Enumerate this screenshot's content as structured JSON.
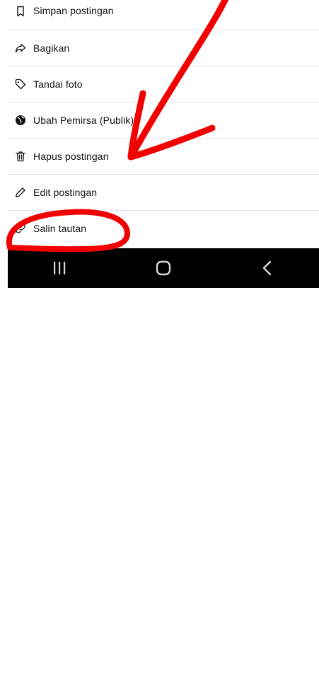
{
  "menu": {
    "items": [
      {
        "label": "Simpan postingan",
        "icon": "bookmark-icon"
      },
      {
        "label": "Bagikan",
        "icon": "share-icon"
      },
      {
        "label": "Tandai foto",
        "icon": "tag-icon"
      },
      {
        "label": "Ubah Pemirsa (Publik)",
        "icon": "globe-icon"
      },
      {
        "label": "Hapus postingan",
        "icon": "trash-icon"
      },
      {
        "label": "Edit postingan",
        "icon": "pencil-icon"
      },
      {
        "label": "Salin tautan",
        "icon": "link-icon"
      }
    ]
  },
  "navbar": {
    "buttons": [
      "recent-apps-icon",
      "home-icon",
      "back-icon"
    ]
  },
  "annotation": {
    "color": "#f20000",
    "shapes": [
      "arrow-pointing-to-hapus-postingan",
      "circle-around-salin-tautan"
    ]
  }
}
